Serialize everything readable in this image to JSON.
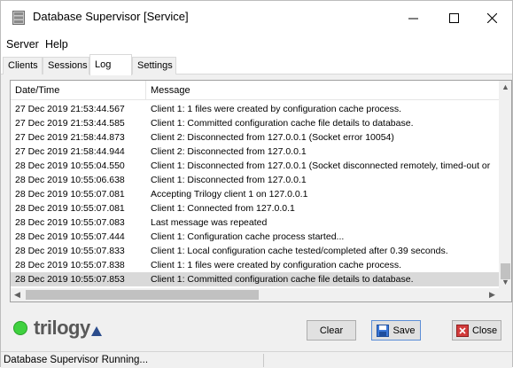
{
  "window": {
    "title": "Database Supervisor [Service]"
  },
  "menu": [
    "Server",
    "Help"
  ],
  "tabs": [
    {
      "label": "Clients",
      "active": false
    },
    {
      "label": "Sessions",
      "active": false
    },
    {
      "label": "Log",
      "active": true
    },
    {
      "label": "Settings",
      "active": false
    }
  ],
  "log": {
    "columns": [
      "Date/Time",
      "Message"
    ],
    "rows": [
      {
        "datetime": "27 Dec 2019 21:53:44.567",
        "message": "Client 1: 1 files were created by configuration cache process."
      },
      {
        "datetime": "27 Dec 2019 21:53:44.585",
        "message": "Client 1: Committed configuration cache file details to database."
      },
      {
        "datetime": "27 Dec 2019 21:58:44.873",
        "message": "Client 2: Disconnected from 127.0.0.1 (Socket error 10054)"
      },
      {
        "datetime": "27 Dec 2019 21:58:44.944",
        "message": "Client 2: Disconnected from 127.0.0.1"
      },
      {
        "datetime": "28 Dec 2019 10:55:04.550",
        "message": "Client 1: Disconnected from 127.0.0.1 (Socket disconnected remotely, timed-out or"
      },
      {
        "datetime": "28 Dec 2019 10:55:06.638",
        "message": "Client 1: Disconnected from 127.0.0.1"
      },
      {
        "datetime": "28 Dec 2019 10:55:07.081",
        "message": "Accepting Trilogy client 1 on 127.0.0.1"
      },
      {
        "datetime": "28 Dec 2019 10:55:07.081",
        "message": "Client 1: Connected from 127.0.0.1"
      },
      {
        "datetime": "28 Dec 2019 10:55:07.083",
        "message": "Last message was repeated"
      },
      {
        "datetime": "28 Dec 2019 10:55:07.444",
        "message": "Client 1: Configuration cache process started..."
      },
      {
        "datetime": "28 Dec 2019 10:55:07.833",
        "message": "Client 1: Local configuration cache tested/completed after 0.39 seconds."
      },
      {
        "datetime": "28 Dec 2019 10:55:07.838",
        "message": "Client 1: 1 files were created by configuration cache process."
      },
      {
        "datetime": "28 Dec 2019 10:55:07.853",
        "message": "Client 1: Committed configuration cache file details to database.",
        "selected": true
      }
    ]
  },
  "logo": {
    "text": "trilogy",
    "color": "#3fd13f"
  },
  "buttons": {
    "clear": "Clear",
    "save": "Save",
    "close": "Close"
  },
  "status": {
    "text": "Database Supervisor Running..."
  },
  "icons": {
    "app": "database-icon",
    "minimize": "minimize-icon",
    "maximize": "maximize-icon",
    "close": "close-icon",
    "save": "floppy-disk-icon",
    "close_button": "red-x-icon"
  }
}
